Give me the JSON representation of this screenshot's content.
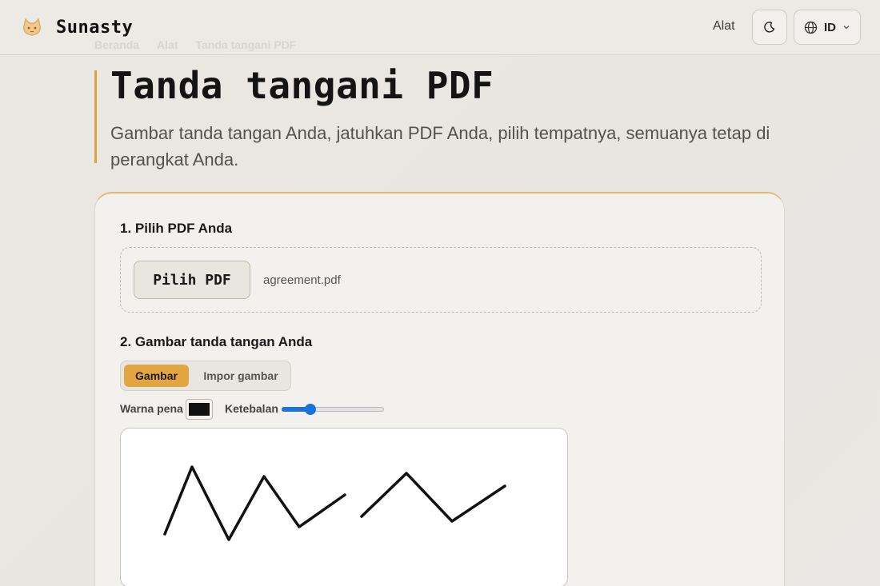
{
  "app": {
    "name": "Sunasty",
    "logo_icon": "cat-icon"
  },
  "header": {
    "tools_label": "Alat",
    "theme_icon": "moon-icon",
    "lang_icon": "globe-icon",
    "lang_code": "ID"
  },
  "breadcrumb": [
    "Beranda",
    "Alat",
    "Tanda tangani PDF"
  ],
  "hero": {
    "title": "Tanda tangani PDF",
    "subtitle": "Gambar tanda tangan Anda, jatuhkan PDF Anda, pilih tempatnya, semuanya tetap di perangkat Anda."
  },
  "step1": {
    "title": "1. Pilih PDF Anda",
    "button_label": "Pilih PDF",
    "file_name": "agreement.pdf"
  },
  "step2": {
    "title": "2. Gambar tanda tangan Anda",
    "modes": [
      {
        "label": "Gambar",
        "active": true
      },
      {
        "label": "Impor gambar",
        "active": false
      }
    ],
    "pen_color_label": "Warna pena",
    "pen_color": "#111111",
    "thickness_label": "Ketebalan",
    "thickness_fraction": 0.25
  },
  "colors": {
    "accent": "#e3a540",
    "slider": "#1a73d9"
  }
}
